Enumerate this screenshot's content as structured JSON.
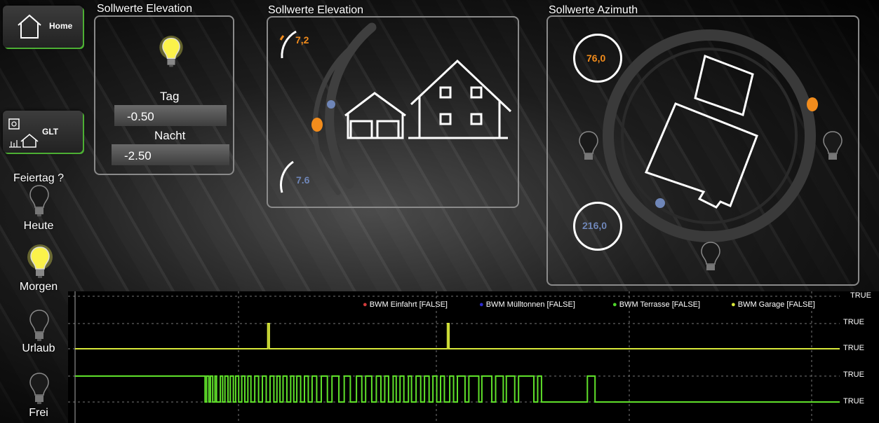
{
  "nav": {
    "home_label": "Home",
    "glt_label": "GLT"
  },
  "elevation_setpoints": {
    "title": "Sollwerte Elevation",
    "tag_label": "Tag",
    "tag_value": "-0.50",
    "nacht_label": "Nacht",
    "nacht_value": "-2.50"
  },
  "elevation_gauge": {
    "title": "Sollwerte Elevation",
    "top_value": "7,2",
    "bottom_value": "7.6"
  },
  "azimuth_gauge": {
    "title": "Sollwerte Azimuth",
    "top_value": "76,0",
    "bottom_value": "216,0"
  },
  "status": {
    "feiertag_label": "Feiertag ?",
    "heute_label": "Heute",
    "morgen_label": "Morgen",
    "urlaub_label": "Urlaub",
    "frei_label": "Frei"
  },
  "colors": {
    "accent_orange": "#f28c1c",
    "accent_blue": "#6f86b8",
    "nav_green": "#4caf33",
    "trace_yellow": "#d8e83a",
    "trace_green": "#5fe02a"
  },
  "chart_data": {
    "type": "line",
    "legend": [
      {
        "name": "BWM Einfahrt [FALSE]",
        "color": "#d33b3b"
      },
      {
        "name": "BWM Mülltonnen [FALSE]",
        "color": "#2b2bd0"
      },
      {
        "name": "BWM Terrasse [FALSE]",
        "color": "#4fd62b"
      },
      {
        "name": "BWM Garage [FALSE]",
        "color": "#d8e83a"
      }
    ],
    "ytick_labels": [
      "TRUE",
      "TRUE",
      "TRUE",
      "TRUE",
      "TRUE"
    ],
    "series": [
      {
        "name": "BWM Garage [FALSE]",
        "pulses": [
          [
            0.252,
            0.254
          ],
          [
            0.487,
            0.489
          ]
        ]
      },
      {
        "name": "BWM Terrasse [FALSE]",
        "toggles": [
          0.17,
          0.172,
          0.175,
          0.177,
          0.18,
          0.183,
          0.185,
          0.19,
          0.193,
          0.196,
          0.2,
          0.203,
          0.207,
          0.21,
          0.214,
          0.218,
          0.222,
          0.226,
          0.23,
          0.235,
          0.24,
          0.245,
          0.25,
          0.255,
          0.26,
          0.264,
          0.268,
          0.272,
          0.277,
          0.282,
          0.286,
          0.29,
          0.295,
          0.3,
          0.305,
          0.31,
          0.316,
          0.322,
          0.33,
          0.336,
          0.345,
          0.352,
          0.36,
          0.368,
          0.375,
          0.38,
          0.388,
          0.394,
          0.4,
          0.405,
          0.41,
          0.416,
          0.42,
          0.425,
          0.43,
          0.436,
          0.44,
          0.446,
          0.452,
          0.457,
          0.463,
          0.468,
          0.473,
          0.478,
          0.483,
          0.49,
          0.495,
          0.5,
          0.51,
          0.515,
          0.528,
          0.532,
          0.545,
          0.55,
          0.56,
          0.564,
          0.575,
          0.58,
          0.6,
          0.605,
          0.61,
          0.67,
          0.68
        ],
        "final_low_from": 0.68
      }
    ]
  }
}
